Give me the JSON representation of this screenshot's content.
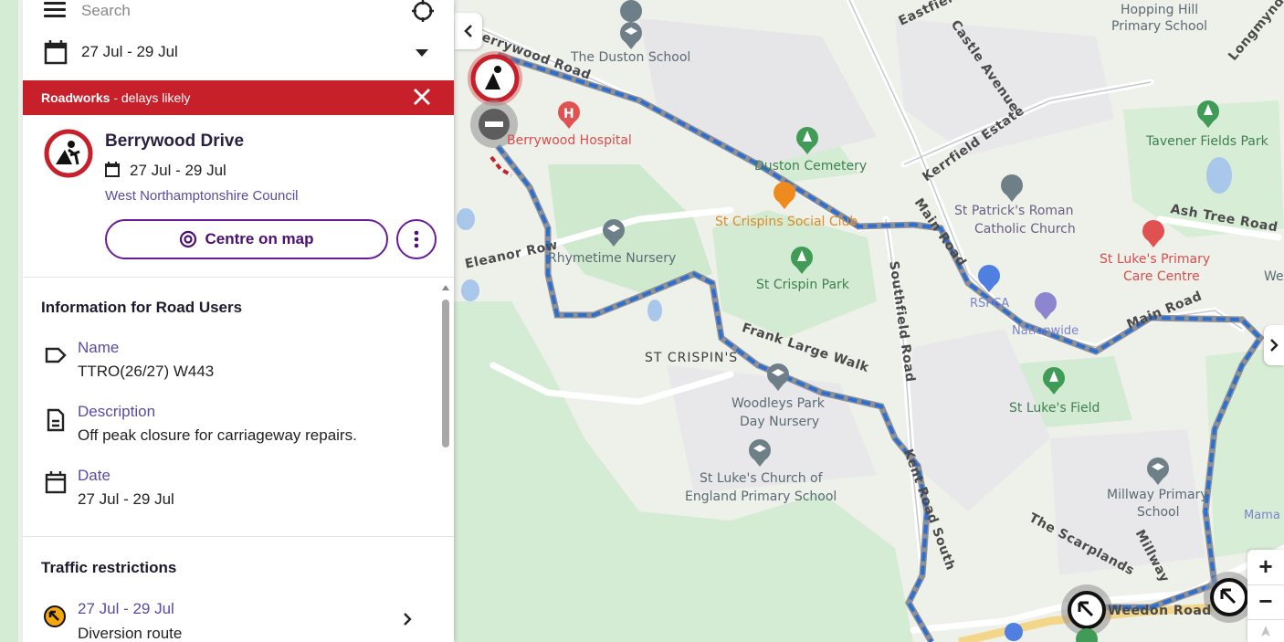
{
  "search": {
    "placeholder": "Search",
    "date_range": "27 Jul - 29 Jul"
  },
  "alert": {
    "title": "Roadworks",
    "subtitle": " - delays likely",
    "color": "#c8202a"
  },
  "incident": {
    "title": "Berrywood Drive",
    "date": "27 Jul - 29 Jul",
    "authority": "West Northamptonshire Council",
    "centre_label": "Centre on map",
    "accent_color": "#6a1b9a"
  },
  "info": {
    "section_title": "Information for Road Users",
    "name_label": "Name",
    "name_value": "TTRO(26/27) W443",
    "description_label": "Description",
    "description_value": "Off peak closure for carriageway repairs.",
    "date_label": "Date",
    "date_value": "27 Jul - 29 Jul"
  },
  "traffic": {
    "section_title": "Traffic restrictions",
    "date": "27 Jul - 29 Jul",
    "label": "Diversion route"
  },
  "icons": {
    "menu": "hamburger-icon",
    "locate": "crosshair-icon",
    "calendar": "calendar-icon",
    "close": "close-icon",
    "roadworks": "roadworks-sign-icon",
    "more": "more-vertical-icon",
    "tag": "tag-icon",
    "document": "document-icon",
    "diversion": "diversion-icon"
  },
  "map": {
    "labels": {
      "duston_school": "The Duston School",
      "berrywood_road": "Berrywood Road",
      "berrywood_hospital": "Berrywood Hospital",
      "duston_cemetery": "Duston Cemetery",
      "st_crispins_social": "St Crispins Social Club",
      "st_crispin_park": "St Crispin Park",
      "rhymetime": "Rhymetime Nursery",
      "eleanor_row": "Eleanor Row",
      "frank_large_walk": "Frank Large Walk",
      "st_crispins": "ST CRISPIN'S",
      "woodleys_1": "Woodleys Park",
      "woodleys_2": "Day Nursery",
      "st_lukes_church_1": "St Luke's Church of",
      "st_lukes_church_2": "England Primary School",
      "kent_road_south": "Kent Road South",
      "southfield_road": "Southfield Road",
      "main_road": "Main Road",
      "main_road_2": "Main Road",
      "kerrfield_estate": "Kerrfield Estate",
      "castle_avenue": "Castle Avenue",
      "eastfield": "Eastfield",
      "st_patricks_1": "St Patrick's Roman",
      "st_patricks_2": "Catholic Church",
      "rspca": "RSPCA",
      "nationwide": "Nationwide",
      "st_lukes_field": "St Luke's Field",
      "st_lukes_primary_1": "St Luke's Primary",
      "st_lukes_primary_2": "Care Centre",
      "ash_tree_road": "Ash Tree Road",
      "tavener_fields": "Tavener Fields Park",
      "hopping_hill_1": "Hopping Hill",
      "hopping_hill_2": "Primary School",
      "longmynd": "Longmynd",
      "the_scarplands": "The Scarplands",
      "millway": "Millway",
      "millway_primary_1": "Millway Primary",
      "millway_primary_2": "School",
      "mama": "Mama",
      "weedon_road": "Weedon Road",
      "we": "We"
    }
  },
  "map_controls": {
    "zoom_in": "+",
    "zoom_out": "−"
  }
}
